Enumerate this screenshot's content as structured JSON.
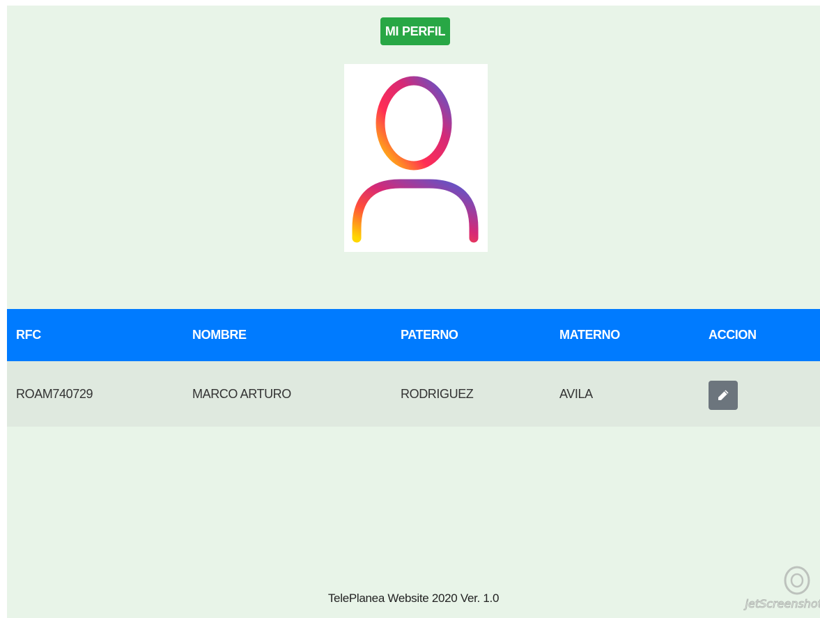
{
  "header": {
    "badge_label": "MI PERFIL"
  },
  "avatar": {
    "icon": "user-icon",
    "gradient": [
      "#ffd600",
      "#ff2d55",
      "#d62976",
      "#8a3ab9",
      "#4f5bd5"
    ]
  },
  "table": {
    "headers": [
      "RFC",
      "NOMBRE",
      "PATERNO",
      "MATERNO",
      "ACCION"
    ],
    "rows": [
      {
        "rfc": "ROAM740729",
        "nombre": "MARCO ARTURO",
        "paterno": "RODRIGUEZ",
        "materno": "AVILA",
        "action_icon": "pencil-icon"
      }
    ]
  },
  "footer": {
    "text": "TelePlanea Website 2020 Ver. 1.0"
  },
  "watermark": {
    "text": "jetScreenshot"
  },
  "colors": {
    "page_background": "#e8f4e8",
    "badge": "#28a745",
    "table_header": "#007bff",
    "row_background": "#dfe9df",
    "edit_button": "#6c757d"
  }
}
